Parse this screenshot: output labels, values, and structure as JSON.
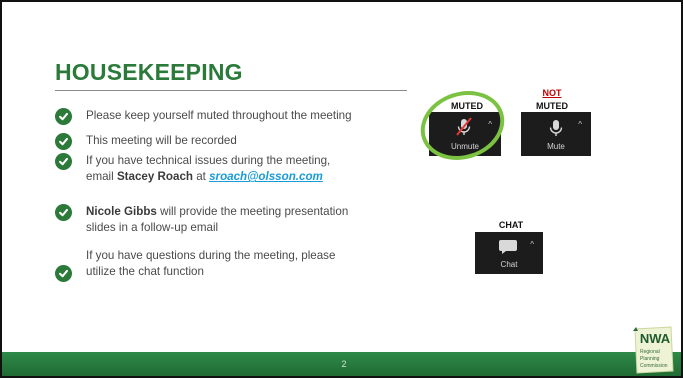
{
  "slide": {
    "title": "HOUSEKEEPING",
    "page_number": "2"
  },
  "bullets": [
    {
      "text": "Please keep yourself muted throughout the meeting"
    },
    {
      "text": "This meeting will be recorded"
    },
    {
      "line1": "If you have technical issues during the meeting,",
      "pre": "email ",
      "name": "Stacey Roach",
      "mid": " at ",
      "email": "sroach@olsson.com"
    },
    {
      "name": "Nicole Gibbs",
      "line1_rest": " will provide the meeting presentation",
      "line2": "slides in a follow-up email"
    },
    {
      "line1": "If you have questions during the meeting, please",
      "line2": "utilize the chat function"
    }
  ],
  "zoom": {
    "muted_label": "MUTED",
    "not_label": "NOT",
    "not_muted_label": "MUTED",
    "chat_label": "CHAT",
    "unmute_button": "Unmute",
    "mute_button": "Mute",
    "chat_button": "Chat"
  },
  "logo": {
    "text": "NWA",
    "sub1": "Regional",
    "sub2": "Planning",
    "sub3": "Commission"
  },
  "colors": {
    "title_green": "#2b7a3a",
    "check_green": "#2b7a3a",
    "ring_green": "#7cc242",
    "link_blue": "#1a9bd7",
    "footer_green": "#2f8a48",
    "not_red": "#c00000"
  }
}
